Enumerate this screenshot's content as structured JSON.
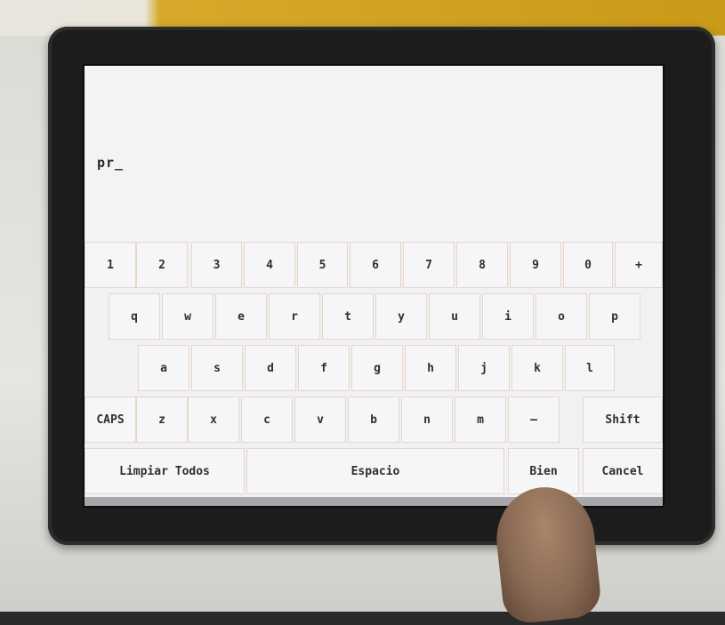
{
  "input": {
    "value": "pr_"
  },
  "keyboard": {
    "row1": [
      "1",
      "2",
      "3",
      "4",
      "5",
      "6",
      "7",
      "8",
      "9",
      "0",
      "+"
    ],
    "row2": [
      "q",
      "w",
      "e",
      "r",
      "t",
      "y",
      "u",
      "i",
      "o",
      "p"
    ],
    "row3": [
      "a",
      "s",
      "d",
      "f",
      "g",
      "h",
      "j",
      "k",
      "l"
    ],
    "row4": [
      "CAPS",
      "z",
      "x",
      "c",
      "v",
      "b",
      "n",
      "m",
      "–",
      "Shift"
    ],
    "row5": {
      "clear_all": "Limpiar Todos",
      "space": "Espacio",
      "ok": "Bien",
      "cancel": "Cancel"
    }
  }
}
